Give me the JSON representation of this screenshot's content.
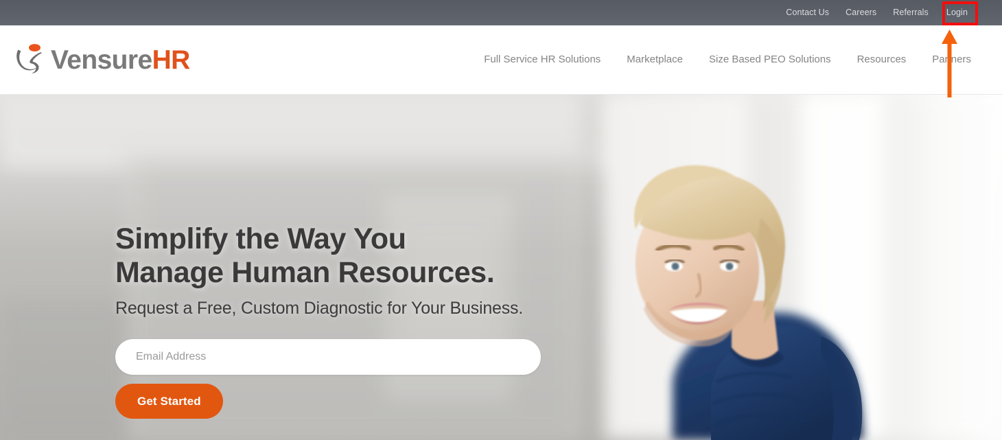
{
  "topbar": {
    "links": [
      {
        "label": "Contact Us",
        "name": "contact-us"
      },
      {
        "label": "Careers",
        "name": "careers"
      },
      {
        "label": "Referrals",
        "name": "referrals"
      },
      {
        "label": "Login",
        "name": "login"
      }
    ],
    "background_color": "#5b6069",
    "text_color": "#dcdde0"
  },
  "header": {
    "logo": {
      "text_primary": "Vensure",
      "text_accent": "HR",
      "primary_color": "#7a7a7a",
      "accent_color": "#e0521b",
      "mark_body_color": "#6e6e6e",
      "mark_head_color": "#e8541c"
    },
    "nav": [
      {
        "label": "Full Service HR Solutions",
        "name": "full-service-hr-solutions"
      },
      {
        "label": "Marketplace",
        "name": "marketplace"
      },
      {
        "label": "Size Based PEO Solutions",
        "name": "size-based-peo-solutions"
      },
      {
        "label": "Resources",
        "name": "resources"
      },
      {
        "label": "Partners",
        "name": "partners"
      }
    ],
    "nav_color": "#848484",
    "background_color": "#ffffff"
  },
  "hero": {
    "title_line1": "Simplify the Way You",
    "title_line2": "Manage Human Resources.",
    "subtitle": "Request a Free, Custom Diagnostic for Your Business.",
    "email_placeholder": "Email Address",
    "email_value": "",
    "cta_label": "Get Started",
    "cta_color": "#e2570f",
    "title_color": "#3a3a3a",
    "photo_description": "Smiling blonde woman in navy blue blouse in a bright blurred office"
  },
  "annotations": {
    "highlight_box": {
      "target": "Login",
      "color": "#f10f0f",
      "shape": "rectangle"
    },
    "arrow": {
      "points_to": "Login",
      "color": "#f4620c",
      "direction": "up"
    }
  }
}
